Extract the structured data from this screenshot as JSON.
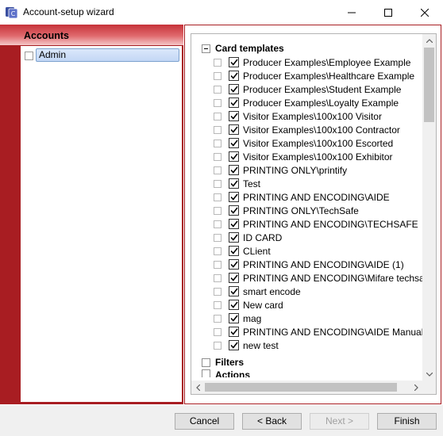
{
  "window": {
    "title": "Account-setup wizard",
    "icon": "app-logo-icon",
    "controls": [
      "minimize-icon",
      "maximize-icon",
      "close-icon"
    ]
  },
  "accounts": {
    "header": "Accounts",
    "items": [
      {
        "label": "Admin",
        "selected": true
      }
    ]
  },
  "tree": {
    "card_templates_label": "Card templates",
    "templates": [
      {
        "label": "Producer Examples\\Employee Example",
        "checked": true
      },
      {
        "label": "Producer Examples\\Healthcare Example",
        "checked": true
      },
      {
        "label": "Producer Examples\\Student Example",
        "checked": true
      },
      {
        "label": "Producer Examples\\Loyalty Example",
        "checked": true
      },
      {
        "label": "Visitor Examples\\100x100 Visitor",
        "checked": true
      },
      {
        "label": "Visitor Examples\\100x100 Contractor",
        "checked": true
      },
      {
        "label": "Visitor Examples\\100x100 Escorted",
        "checked": true
      },
      {
        "label": "Visitor Examples\\100x100 Exhibitor",
        "checked": true
      },
      {
        "label": "PRINTING ONLY\\printify",
        "checked": true
      },
      {
        "label": "Test",
        "checked": true
      },
      {
        "label": "PRINTING AND ENCODING\\AIDE",
        "checked": true
      },
      {
        "label": "PRINTING ONLY\\TechSafe",
        "checked": true
      },
      {
        "label": "PRINTING AND ENCODING\\TECHSAFE",
        "checked": true
      },
      {
        "label": "ID CARD",
        "checked": true
      },
      {
        "label": "CLient",
        "checked": true
      },
      {
        "label": "PRINTING AND ENCODING\\AIDE (1)",
        "checked": true
      },
      {
        "label": "PRINTING AND ENCODING\\Mifare techsa",
        "checked": true
      },
      {
        "label": "smart encode",
        "checked": true
      },
      {
        "label": "New card",
        "checked": true
      },
      {
        "label": "mag",
        "checked": true
      },
      {
        "label": "PRINTING AND ENCODING\\AIDE Manual",
        "checked": true
      },
      {
        "label": "new test",
        "checked": true
      }
    ],
    "filters_label": "Filters",
    "partial_label": "Actions"
  },
  "buttons": {
    "cancel": "Cancel",
    "back": "< Back",
    "next": "Next >",
    "finish": "Finish"
  },
  "colors": {
    "accent_red": "#a81d22",
    "selection": "#c3d7f5"
  }
}
